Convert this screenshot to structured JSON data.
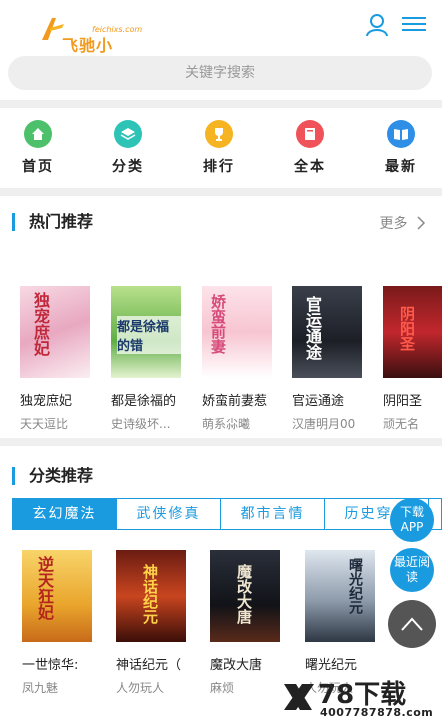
{
  "header": {
    "logo_en": "feichixs.com",
    "logo_cn": "飞驰小说网",
    "search_placeholder": "关键字搜索"
  },
  "nav": [
    {
      "label": "首页",
      "icon": "home-icon",
      "color": "#4cc06a"
    },
    {
      "label": "分类",
      "icon": "layers-icon",
      "color": "#2dc3b6"
    },
    {
      "label": "排行",
      "icon": "trophy-icon",
      "color": "#f6b322"
    },
    {
      "label": "全本",
      "icon": "book-icon",
      "color": "#f0525a"
    },
    {
      "label": "最新",
      "icon": "open-book-icon",
      "color": "#2f8fe6"
    }
  ],
  "hot": {
    "title": "热门推荐",
    "more": "更多",
    "books": [
      {
        "name": "独宠庶妃",
        "author": "天天逗比",
        "cover_text": "独宠庶妃"
      },
      {
        "name": "都是徐福的",
        "author": "史诗级坏...",
        "cover_text": "都是徐福的错"
      },
      {
        "name": "娇蛮前妻惹",
        "author": "萌系尛曦",
        "cover_text": "娇蛮前妻"
      },
      {
        "name": "官运通途",
        "author": "汉唐明月00",
        "cover_text": "官运通途"
      },
      {
        "name": "阴阳圣",
        "author": "顽无名",
        "cover_text": "阴阳圣"
      }
    ]
  },
  "category": {
    "title": "分类推荐",
    "tabs": [
      "玄幻魔法",
      "武侠修真",
      "都市言情",
      "历史穿越"
    ],
    "books": [
      {
        "name": "一世惊华:",
        "author": "凤九魅",
        "cover_text": "逆天狂妃"
      },
      {
        "name": "神话纪元（",
        "author": "人勿玩人",
        "cover_text": "神话纪元"
      },
      {
        "name": "魔改大唐",
        "author": "麻烦",
        "cover_text": "魔改大唐"
      },
      {
        "name": "曙光纪元",
        "author": "人勿玩人",
        "cover_text": "曙光纪元"
      }
    ]
  },
  "float": {
    "download": "下载APP",
    "recent": "最近阅读"
  },
  "watermark": {
    "text": "78下载",
    "url": "4007787878.com"
  }
}
